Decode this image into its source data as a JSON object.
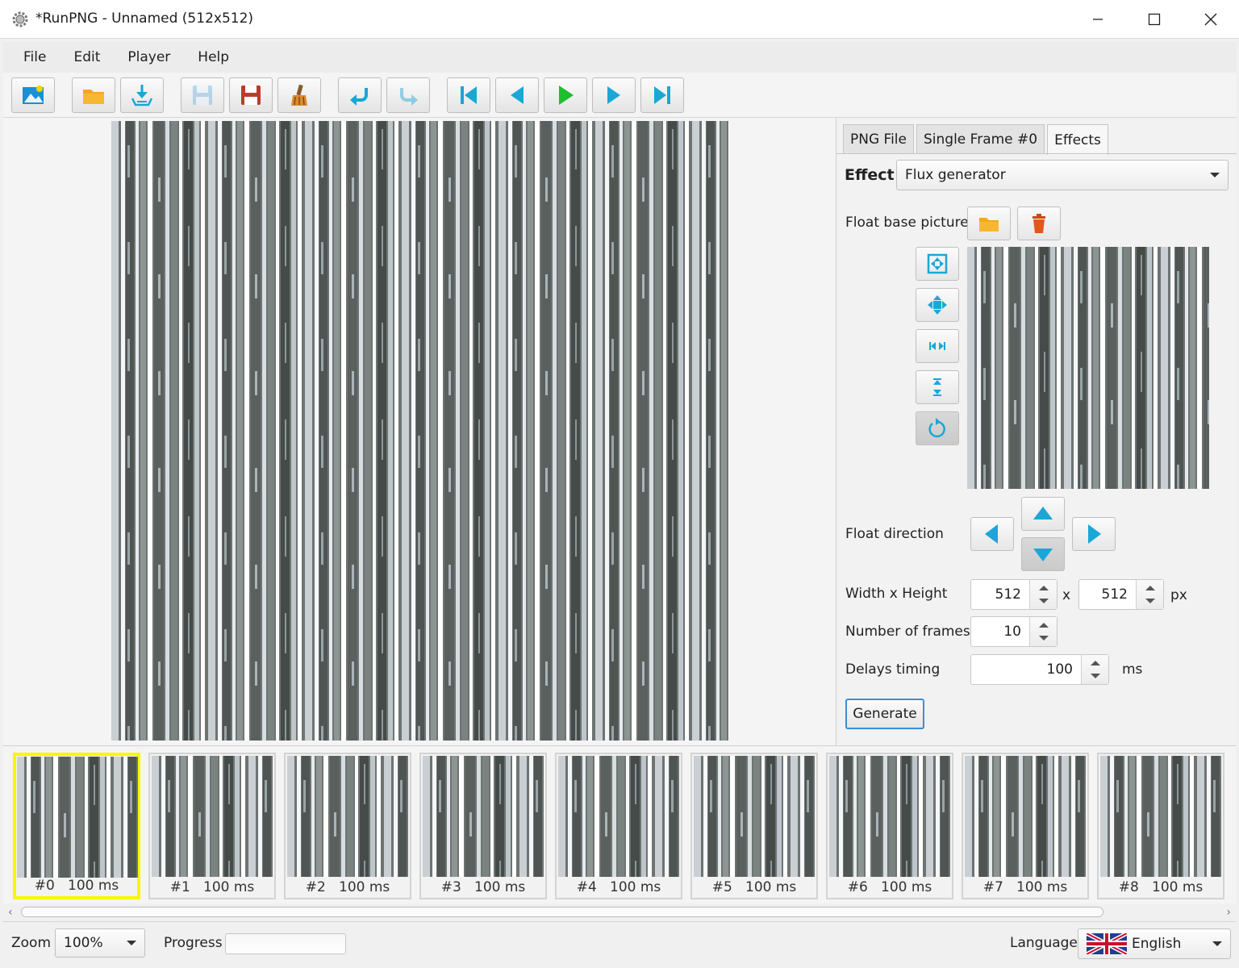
{
  "window": {
    "title": "*RunPNG - Unnamed (512x512)"
  },
  "menu": [
    "File",
    "Edit",
    "Player",
    "Help"
  ],
  "toolbar": {
    "buttons": [
      {
        "name": "new-image",
        "icon": "image-icon"
      },
      {
        "name": "open",
        "icon": "folder-icon"
      },
      {
        "name": "import",
        "icon": "import-icon"
      },
      {
        "name": "save",
        "icon": "floppy-icon",
        "disabled": true
      },
      {
        "name": "save-as",
        "icon": "floppy-red-icon"
      },
      {
        "name": "clean",
        "icon": "brush-icon"
      },
      {
        "name": "undo",
        "icon": "undo-icon"
      },
      {
        "name": "redo",
        "icon": "redo-icon",
        "disabled": true
      },
      {
        "name": "first-frame",
        "icon": "skip-first-icon"
      },
      {
        "name": "previous-frame",
        "icon": "previous-icon"
      },
      {
        "name": "play",
        "icon": "play-icon"
      },
      {
        "name": "next-frame",
        "icon": "next-icon"
      },
      {
        "name": "last-frame",
        "icon": "skip-last-icon"
      }
    ]
  },
  "panel": {
    "tabs": [
      "PNG File",
      "Single Frame #0",
      "Effects"
    ],
    "active_tab": "Effects",
    "effect_label": "Effect",
    "effect_value": "Flux generator",
    "float_base_label": "Float base picture",
    "float_direction_label": "Float direction",
    "width_height_label": "Width x Height",
    "width": "512",
    "times": "x",
    "height": "512",
    "px": "px",
    "frames_label": "Number of frames",
    "frames": "10",
    "delays_label": "Delays timing",
    "delay": "100",
    "ms": "ms",
    "generate": "Generate"
  },
  "frames": [
    {
      "index": "#0",
      "delay": "100 ms"
    },
    {
      "index": "#1",
      "delay": "100 ms"
    },
    {
      "index": "#2",
      "delay": "100 ms"
    },
    {
      "index": "#3",
      "delay": "100 ms"
    },
    {
      "index": "#4",
      "delay": "100 ms"
    },
    {
      "index": "#5",
      "delay": "100 ms"
    },
    {
      "index": "#6",
      "delay": "100 ms"
    },
    {
      "index": "#7",
      "delay": "100 ms"
    },
    {
      "index": "#8",
      "delay": "100 ms"
    }
  ],
  "selected_frame": "#0",
  "status": {
    "zoom_label": "Zoom",
    "zoom_value": "100%",
    "progress_label": "Progress",
    "progress": 0,
    "language_label": "Language",
    "language_value": "English"
  },
  "colors": {
    "accent_cyan": "#1aa7d6",
    "play_green": "#1fbf2c",
    "selection_yellow": "#f7f700",
    "folder_orange": "#f5a623"
  }
}
